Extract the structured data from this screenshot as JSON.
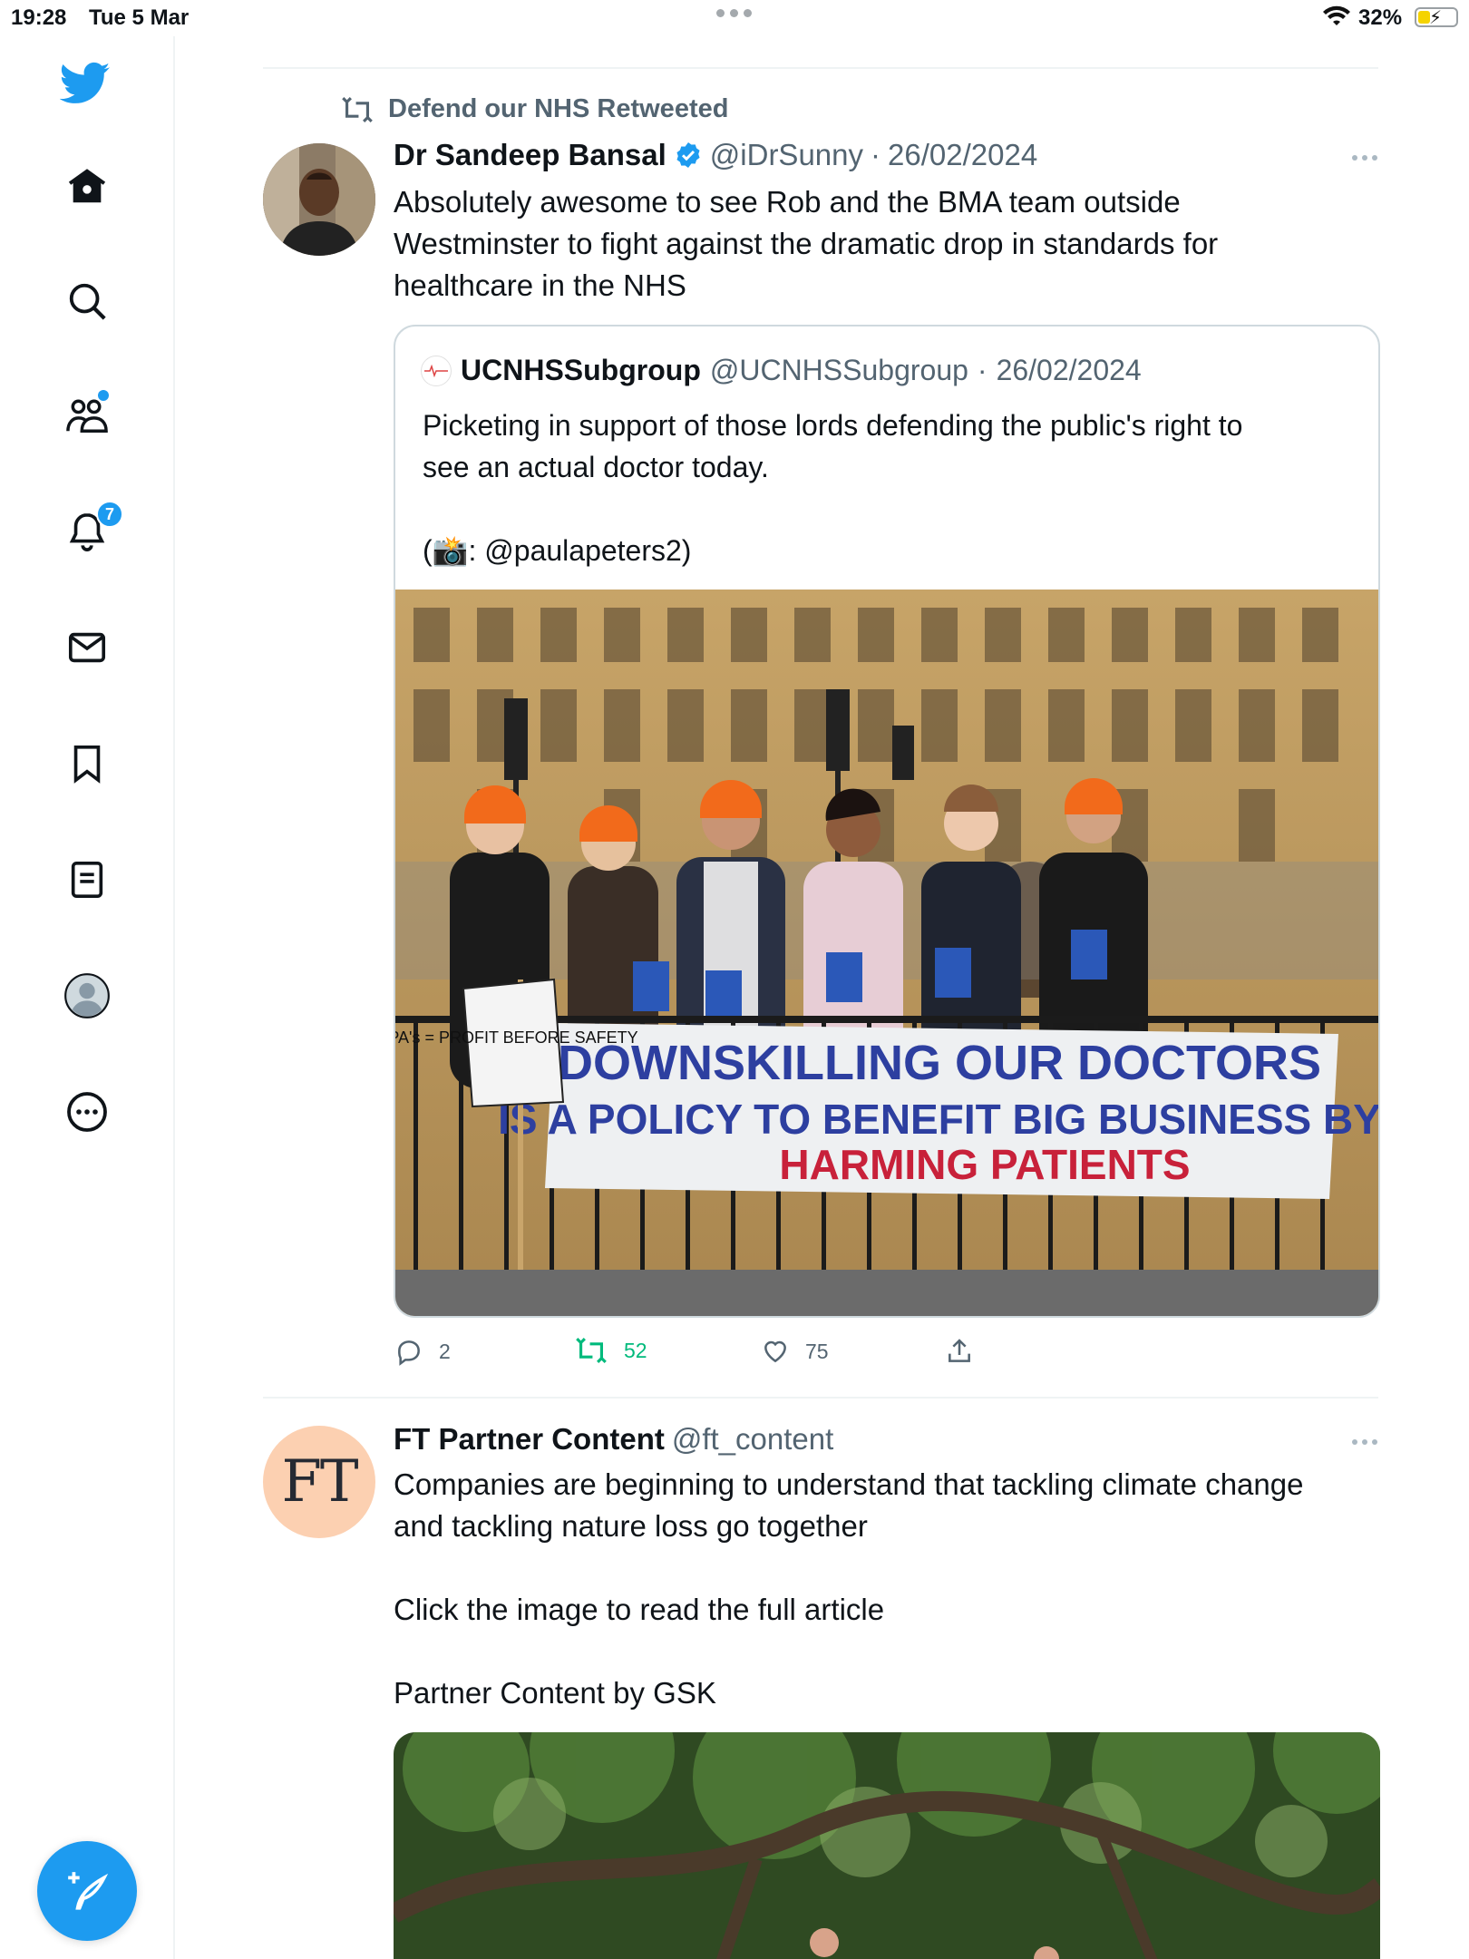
{
  "status_bar": {
    "time": "19:28",
    "date": "Tue 5 Mar",
    "battery_percent": "32%",
    "battery_level": 0.32
  },
  "sidebar": {
    "items": [
      {
        "name": "home",
        "icon": "home-icon"
      },
      {
        "name": "explore",
        "icon": "search-icon"
      },
      {
        "name": "communities",
        "icon": "communities-icon",
        "has_dot": true
      },
      {
        "name": "notifications",
        "icon": "bell-icon",
        "badge": "7"
      },
      {
        "name": "messages",
        "icon": "mail-icon"
      },
      {
        "name": "bookmarks",
        "icon": "bookmark-icon"
      },
      {
        "name": "lists",
        "icon": "list-icon"
      },
      {
        "name": "profile",
        "icon": "avatar-icon"
      },
      {
        "name": "more",
        "icon": "more-circle-icon"
      }
    ],
    "compose_icon": "compose-icon"
  },
  "tweets": [
    {
      "retweeted_by": "Defend our NHS Retweeted",
      "author_name": "Dr Sandeep Bansal",
      "verified": true,
      "handle": "@iDrSunny",
      "separator": "·",
      "date": "26/02/2024",
      "text": "Absolutely awesome to see Rob and the BMA team outside\nWestminster to fight against the dramatic drop in standards for\nhealthcare in the NHS",
      "quote": {
        "author_name": "UCNHSSubgroup",
        "handle": "@UCNHSSubgroup",
        "separator": "·",
        "date": "26/02/2024",
        "text": "Picketing in support of those lords defending the public's right to\nsee an actual doctor today.\n\n(📸: @paulapeters2)",
        "banner_line1": "DOWNSKILLING OUR DOCTORS",
        "banner_line2": "IS A POLICY TO BENEFIT BIG BUSINESS BY",
        "banner_line3": "HARMING PATIENTS",
        "sign_text": "PA's = PROFIT BEFORE SAFETY"
      },
      "actions": {
        "replies": "2",
        "retweets": "52",
        "likes": "75"
      }
    },
    {
      "author_name": "FT Partner Content",
      "handle": "@ft_content",
      "avatar_text": "FT",
      "text": "Companies are beginning to understand that tackling climate change\nand tackling nature loss go together\n\nClick the image to read the full article\n\nPartner Content by GSK"
    }
  ],
  "colors": {
    "accent": "#1d9bf0",
    "retweet_green": "#00ba7c",
    "muted": "#536471",
    "ft_pink": "#fcd0b1"
  }
}
